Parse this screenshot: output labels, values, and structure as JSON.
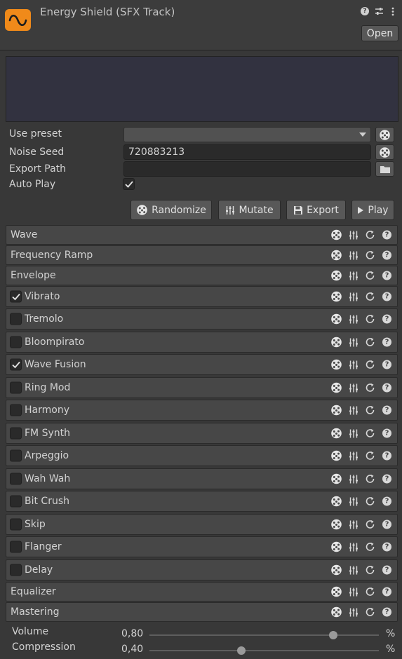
{
  "header": {
    "title": "Energy Shield (SFX Track)",
    "open_label": "Open"
  },
  "fields": {
    "use_preset_label": "Use preset",
    "preset_value": "",
    "noise_seed_label": "Noise Seed",
    "noise_seed_value": "720883213",
    "export_path_label": "Export Path",
    "export_path_value": "",
    "auto_play_label": "Auto Play",
    "auto_play_checked": true
  },
  "actions": {
    "randomize": "Randomize",
    "mutate": "Mutate",
    "export": "Export",
    "play": "Play"
  },
  "sections": [
    {
      "label": "Wave",
      "has_checkbox": false,
      "checked": false
    },
    {
      "label": "Frequency Ramp",
      "has_checkbox": false,
      "checked": false
    },
    {
      "label": "Envelope",
      "has_checkbox": false,
      "checked": false
    },
    {
      "label": "Vibrato",
      "has_checkbox": true,
      "checked": true
    },
    {
      "label": "Tremolo",
      "has_checkbox": true,
      "checked": false
    },
    {
      "label": "Bloompirato",
      "has_checkbox": true,
      "checked": false
    },
    {
      "label": "Wave Fusion",
      "has_checkbox": true,
      "checked": true
    },
    {
      "label": "Ring Mod",
      "has_checkbox": true,
      "checked": false
    },
    {
      "label": "Harmony",
      "has_checkbox": true,
      "checked": false
    },
    {
      "label": "FM Synth",
      "has_checkbox": true,
      "checked": false
    },
    {
      "label": "Arpeggio",
      "has_checkbox": true,
      "checked": false
    },
    {
      "label": "Wah Wah",
      "has_checkbox": true,
      "checked": false
    },
    {
      "label": "Bit Crush",
      "has_checkbox": true,
      "checked": false
    },
    {
      "label": "Skip",
      "has_checkbox": true,
      "checked": false
    },
    {
      "label": "Flanger",
      "has_checkbox": true,
      "checked": false
    },
    {
      "label": "Delay",
      "has_checkbox": true,
      "checked": false
    },
    {
      "label": "Equalizer",
      "has_checkbox": false,
      "checked": false
    },
    {
      "label": "Mastering",
      "has_checkbox": false,
      "checked": false
    }
  ],
  "mastering": {
    "volume_label": "Volume",
    "volume_value": "0,80",
    "volume_fraction": 0.8,
    "compression_label": "Compression",
    "compression_value": "0,40",
    "compression_fraction": 0.4,
    "unit": "%"
  },
  "colors": {
    "accent": "#f08a1a",
    "panel": "#474747",
    "background": "#383838"
  }
}
